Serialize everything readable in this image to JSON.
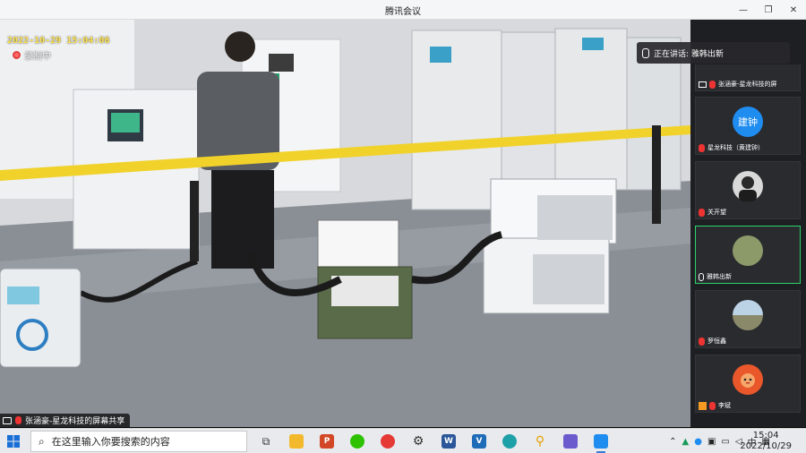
{
  "window": {
    "title": "腾讯会议"
  },
  "video": {
    "timestamp": "2022-10-29 15:04:06",
    "rec_status": "录制中",
    "speaker_caption": "张涵豪-星龙科技的屏幕共享",
    "speaking_label": "正在讲话: 雅韩出新"
  },
  "participants": [
    {
      "name": "张涵豪-星龙科技的屏",
      "avatar_text": ""
    },
    {
      "name": "星龙科技（黄建钟）",
      "avatar_text": "建钟",
      "avatar_color": "#1f8cf0"
    },
    {
      "name": "关开望",
      "avatar_text": ""
    },
    {
      "name": "雅韩出新",
      "avatar_text": ""
    },
    {
      "name": "罗恒鑫",
      "avatar_text": ""
    },
    {
      "name": "李斌",
      "avatar_text": ""
    }
  ],
  "taskbar": {
    "search_placeholder": "在这里输入你要搜索的内容",
    "ime": "中",
    "time": "15:04",
    "date": "2022/10/29"
  },
  "colors": {
    "active_border": "#2bd36a",
    "accent": "#1f8cf0",
    "timestamp": "#ffe44d"
  }
}
